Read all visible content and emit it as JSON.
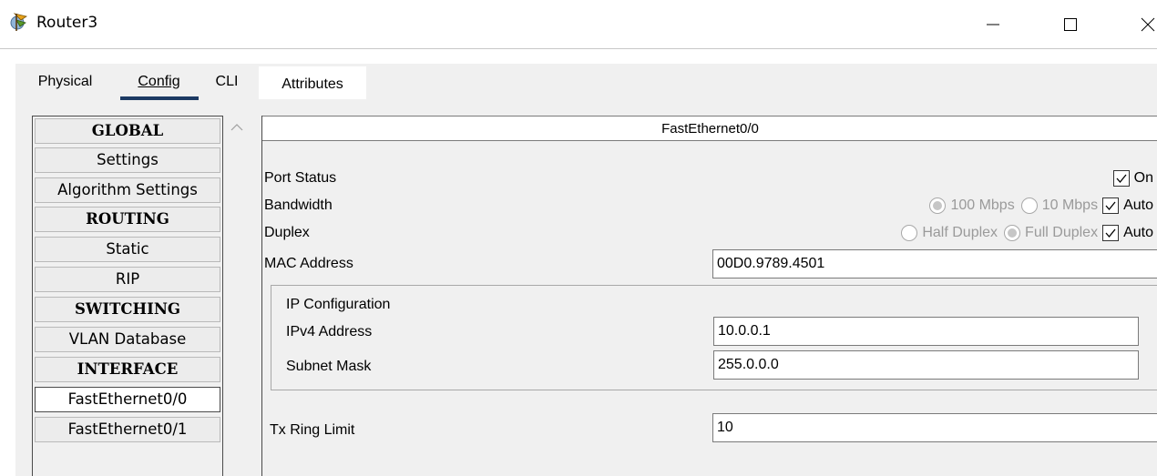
{
  "window": {
    "title": "Router3",
    "icon": "router-app-icon",
    "minimize_icon": "minimize-icon",
    "maximize_icon": "maximize-icon",
    "close_icon": "close-icon"
  },
  "tabs": [
    {
      "label": "Physical"
    },
    {
      "label": "Config"
    },
    {
      "label": "CLI"
    },
    {
      "label": "Attributes"
    }
  ],
  "sidebar": {
    "items": [
      {
        "label": "GLOBAL",
        "type": "header"
      },
      {
        "label": "Settings",
        "type": "item"
      },
      {
        "label": "Algorithm Settings",
        "type": "item"
      },
      {
        "label": "ROUTING",
        "type": "header"
      },
      {
        "label": "Static",
        "type": "item"
      },
      {
        "label": "RIP",
        "type": "item"
      },
      {
        "label": "SWITCHING",
        "type": "header"
      },
      {
        "label": "VLAN Database",
        "type": "item"
      },
      {
        "label": "INTERFACE",
        "type": "header"
      },
      {
        "label": "FastEthernet0/0",
        "type": "item",
        "selected": true
      },
      {
        "label": "FastEthernet0/1",
        "type": "item"
      }
    ]
  },
  "panel": {
    "title": "FastEthernet0/0",
    "port_status": {
      "label": "Port Status",
      "on_label": "On",
      "on_checked": true
    },
    "bandwidth": {
      "label": "Bandwidth",
      "opt1": "100 Mbps",
      "opt2": "10 Mbps",
      "auto_label": "Auto",
      "auto_checked": true
    },
    "duplex": {
      "label": "Duplex",
      "opt1": "Half Duplex",
      "opt2": "Full Duplex",
      "auto_label": "Auto",
      "auto_checked": true
    },
    "mac": {
      "label": "MAC Address",
      "value": "00D0.9789.4501"
    },
    "ip_config": {
      "title": "IP Configuration",
      "ipv4_label": "IPv4 Address",
      "ipv4_value": "10.0.0.1",
      "mask_label": "Subnet Mask",
      "mask_value": "255.0.0.0"
    },
    "tx_ring": {
      "label": "Tx Ring Limit",
      "value": "10"
    }
  },
  "colors": {
    "tab_underline": "#1c3a63",
    "panel_bg": "#f0f0f0",
    "disabled_text": "#9a9a9a"
  }
}
